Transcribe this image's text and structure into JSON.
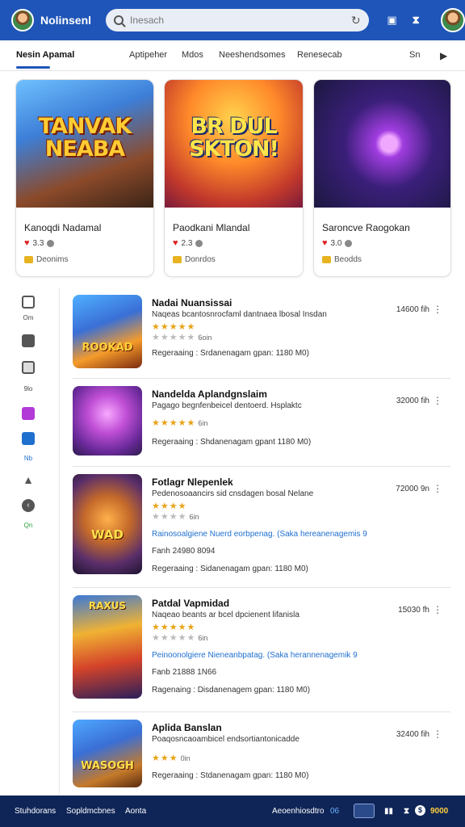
{
  "header": {
    "title": "Nolinsenl",
    "search_placeholder": "Inesach",
    "icons": [
      "avatar",
      "search-icon",
      "refresh-icon",
      "store-icon",
      "filter-icon",
      "profile-avatar"
    ]
  },
  "tabs": [
    {
      "label": "Nesin Apamal",
      "active": true
    },
    {
      "label": "Aptipeher"
    },
    {
      "label": "Mdos"
    },
    {
      "label": "Neeshendsomes"
    },
    {
      "label": "Renesecab"
    },
    {
      "label": "Sn"
    }
  ],
  "featured": [
    {
      "art_text": "TANVAK NEABA",
      "name": "Kanoqdi Nadamal",
      "rating": "3.3",
      "genre": "Deonims"
    },
    {
      "art_text": "BR DUL SKTON!",
      "name": "Paodkani Mlandal",
      "rating": "2.3",
      "genre": "Donrdos"
    },
    {
      "art_text": "",
      "name": "Saroncve Raogokan",
      "rating": "3.0",
      "genre": "Beodds"
    }
  ],
  "sidebar": {
    "items": [
      {
        "label": "Om",
        "icon": "grid-icon"
      },
      {
        "label": "",
        "icon": "square-icon"
      },
      {
        "label": "9lo",
        "icon": "doc-icon"
      },
      {
        "label": "",
        "icon": "purple-icon"
      },
      {
        "label": "Nb",
        "icon": "blue-icon"
      },
      {
        "label": "",
        "icon": "home-icon"
      },
      {
        "label": "Qn",
        "icon": "back-icon"
      }
    ]
  },
  "apps": [
    {
      "title": "Nadai Nuansissai",
      "desc": "Naqeas bcantosnrocfaml dantnaea lbosal Insdan",
      "stars": "★★★★★",
      "stars2": "★★★★★",
      "meta": "6oin",
      "storage": "Regeraaing : Srdanenagam gpan: 1180 M0)",
      "size": "14600 fih",
      "thumb_text": "ROOKAD"
    },
    {
      "title": "Nandelda Aplandgnslaim",
      "desc": "Pagago begnfenbeicel dentoerd. Hsplaktc",
      "stars": "★★★★★",
      "meta": "6in",
      "storage": "Regeraaing : Shdanenagam gpant 1180 M0)",
      "size": "32000 fih",
      "thumb_text": ""
    },
    {
      "title": "Fotlagr Nlepenlek",
      "desc": "Pedenosoaancirs sid cnsdagen bosal Nelane",
      "stars": "★★★★",
      "meta": "6in",
      "link": "Rainosoalgiene Nuerd eorbpenag. (Saka hereanenagemis 9",
      "extra": "Fanh 24980 8094",
      "storage": "Regeraaing : Sidanenagam gpan: 1180 M0)",
      "size": "72000 9n",
      "thumb_text": "WAD"
    },
    {
      "title": "Patdal Vapmidad",
      "desc": "Naqeao beants ar bcel dpcienent lifanisla",
      "stars": "★★★★★",
      "stars2": "★★★★★",
      "meta": "6in",
      "link": "Peinoonolgiere Nieneanbpatag. (Saka herannenagemik 9",
      "extra": "Fanb 21888 1N66",
      "storage": "Ragenaing : Disdanenagem gpan: 1180 M0)",
      "size": "15030 fh",
      "thumb_text": "RAXUS"
    },
    {
      "title": "Aplida Banslan",
      "desc": "Poaqosncaoambicel endsortiantonicadde",
      "stars": "★★★",
      "meta": "0in",
      "storage": "Regeraaing : Stdanenagam gpan: 1180 M0)",
      "size": "32400 fih",
      "thumb_text": "WASOGH"
    }
  ],
  "bottom": {
    "left": [
      "Stuhdorans",
      "Sopldmcbnes",
      "Aonta"
    ],
    "right_label": "Aeoenhiosdtro",
    "count": "06",
    "coins": "9000"
  },
  "colors": {
    "brand": "#1f55b8",
    "star": "#e8a316",
    "link": "#1f6fcf",
    "bottom_bar": "#0f2557"
  }
}
